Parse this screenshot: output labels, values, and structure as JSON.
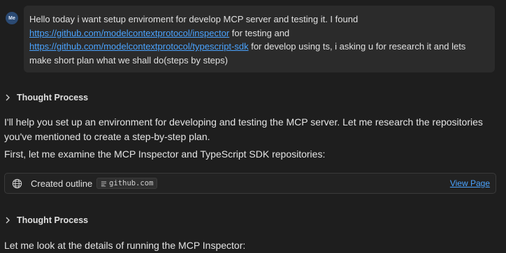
{
  "user_message": {
    "avatar_initials": "Me",
    "text_before_link1": "Hello today i want setup enviroment for develop MCP server and testing it. I found ",
    "link1": "https://github.com/modelcontextprotocol/inspector",
    "text_after_link1": " for testing and ",
    "link2": "https://github.com/modelcontextprotocol/typescript-sdk",
    "text_after_link2": " for develop using ts, i asking u for research it and lets make short plan what we shall do(steps by steps)"
  },
  "thought_1": {
    "label": "Thought Process"
  },
  "response": {
    "paragraph_1": "I'll help you set up an environment for developing and testing the MCP server. Let me research the repositories you've mentioned to create a step-by-step plan.",
    "paragraph_2": "First, let me examine the MCP Inspector and TypeScript SDK repositories:"
  },
  "tool_call": {
    "label": "Created outline",
    "source": "github.com",
    "action_link": "View Page",
    "icon": "globe-icon"
  },
  "thought_2": {
    "label": "Thought Process"
  },
  "response_2": {
    "paragraph_1": "Let me look at the details of running the MCP Inspector:"
  },
  "colors": {
    "background": "#1e1e1e",
    "bubble": "#2b2b2b",
    "link": "#4aa3ff",
    "avatar": "#2b4a73"
  }
}
